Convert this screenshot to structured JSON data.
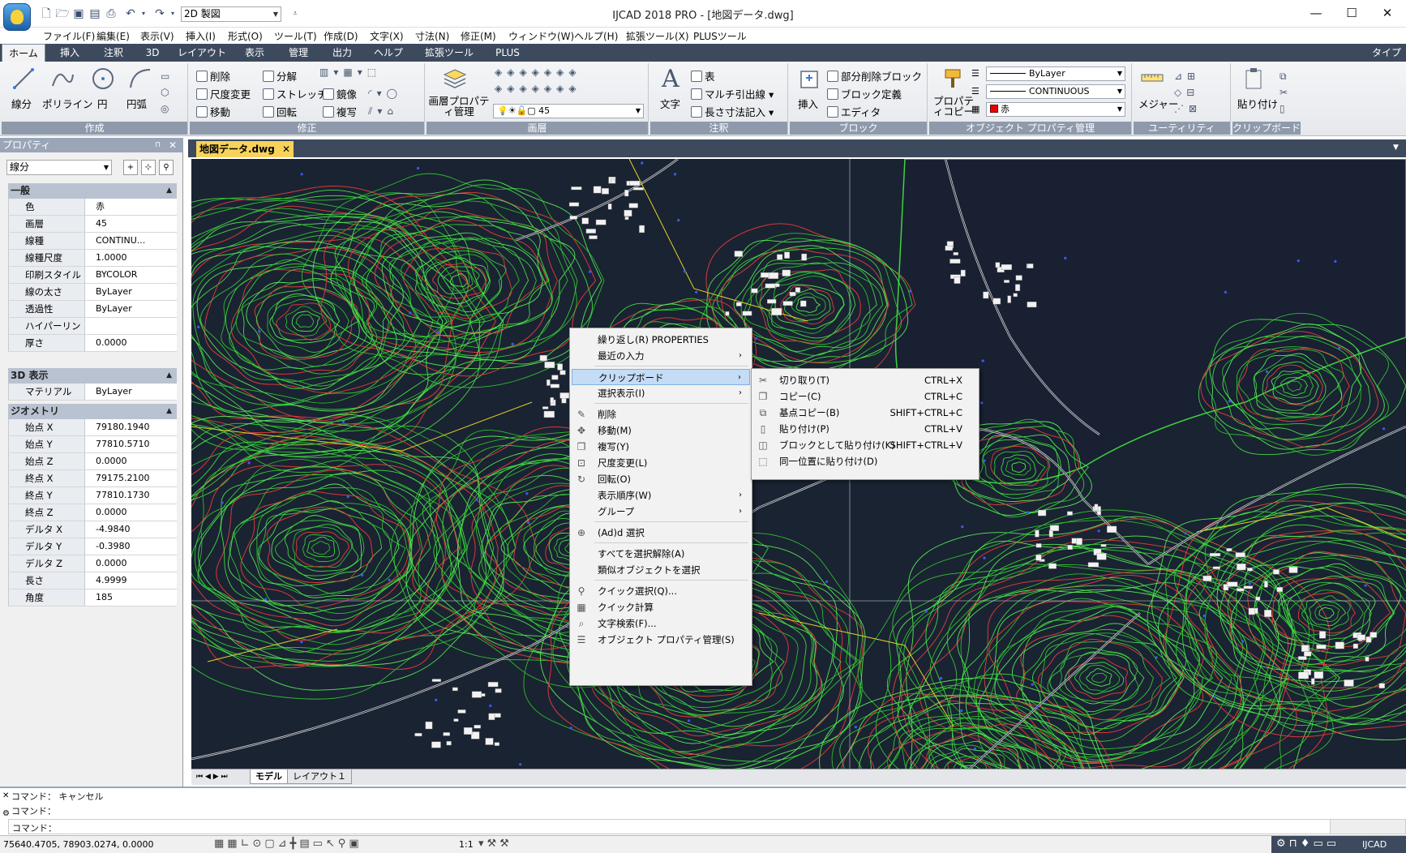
{
  "window": {
    "workspace": "2D 製図",
    "title": "IJCAD 2018 PRO - [地図データ.dwg]",
    "minimize": "—",
    "maximize": "☐",
    "close": "✕"
  },
  "menubar": [
    "ファイル(F)",
    "編集(E)",
    "表示(V)",
    "挿入(I)",
    "形式(O)",
    "ツール(T)",
    "作成(D)",
    "文字(X)",
    "寸法(N)",
    "修正(M)",
    "ウィンドウ(W)",
    "ヘルプ(H)",
    "拡張ツール(X)",
    "PLUSツール"
  ],
  "ribbon_tabs": [
    "ホーム",
    "挿入",
    "注釈",
    "3D",
    "レイアウト",
    "表示",
    "管理",
    "出力",
    "ヘルプ",
    "拡張ツール",
    "PLUS"
  ],
  "ribbon_right": "タイプ",
  "ribbon": {
    "draw": {
      "title": "作成",
      "line": "線分",
      "polyline": "ポリライン",
      "circle": "円",
      "arc": "円弧"
    },
    "modify": {
      "title": "修正",
      "erase": "削除",
      "explode": "分解",
      "scale": "尺度変更",
      "stretch": "ストレッチ",
      "mirror": "鏡像",
      "move": "移動",
      "rotate": "回転",
      "copy": "複写"
    },
    "layer": {
      "title": "画層",
      "manager": "画層プロパティ管理",
      "current_layer": "45"
    },
    "annotation": {
      "title": "注釈",
      "text": "文字",
      "table": "表",
      "mleader": "マルチ引出線",
      "dimension": "長さ寸法記入"
    },
    "block": {
      "title": "ブロック",
      "insert": "挿入",
      "partial_delete": "部分削除ブロック",
      "define": "ブロック定義",
      "editor": "エディタ"
    },
    "properties": {
      "title": "オブジェクト プロパティ管理",
      "match": "プロパティコピー",
      "lineweight": "ByLayer",
      "linetype": "CONTINUOUS",
      "color": "赤"
    },
    "utilities": {
      "title": "ユーティリティ",
      "measure": "メジャー"
    },
    "clipboard": {
      "title": "クリップボード",
      "paste": "貼り付け"
    }
  },
  "properties_panel": {
    "title": "プロパティ",
    "object_type": "線分",
    "sections": {
      "general": "一般",
      "display3d": "3D 表示",
      "geometry": "ジオメトリ"
    },
    "general": [
      {
        "k": "色",
        "v": "赤"
      },
      {
        "k": "画層",
        "v": "45"
      },
      {
        "k": "線種",
        "v": "CONTINU..."
      },
      {
        "k": "線種尺度",
        "v": "1.0000"
      },
      {
        "k": "印刷スタイル",
        "v": "BYCOLOR"
      },
      {
        "k": "線の太さ",
        "v": "ByLayer"
      },
      {
        "k": "透過性",
        "v": "ByLayer"
      },
      {
        "k": "ハイパーリンク",
        "v": ""
      },
      {
        "k": "厚さ",
        "v": "0.0000"
      }
    ],
    "display3d": [
      {
        "k": "マテリアル",
        "v": "ByLayer"
      }
    ],
    "geometry": [
      {
        "k": "始点 X",
        "v": "79180.1940"
      },
      {
        "k": "始点 Y",
        "v": "77810.5710"
      },
      {
        "k": "始点 Z",
        "v": "0.0000"
      },
      {
        "k": "終点 X",
        "v": "79175.2100"
      },
      {
        "k": "終点 Y",
        "v": "77810.1730"
      },
      {
        "k": "終点 Z",
        "v": "0.0000"
      },
      {
        "k": "デルタ X",
        "v": "-4.9840"
      },
      {
        "k": "デルタ Y",
        "v": "-0.3980"
      },
      {
        "k": "デルタ Z",
        "v": "0.0000"
      },
      {
        "k": "長さ",
        "v": "4.9999"
      },
      {
        "k": "角度",
        "v": "185"
      }
    ]
  },
  "document": {
    "tab": "地図データ.dwg",
    "close": "✕"
  },
  "layout_tabs": {
    "model": "モデル",
    "layout1": "レイアウト１"
  },
  "context_menu": {
    "items": [
      {
        "label": "繰り返し(R) PROPERTIES"
      },
      {
        "label": "最近の入力",
        "sub": true
      },
      {
        "label": "クリップボード",
        "sub": true,
        "highlight": true
      },
      {
        "label": "選択表示(I)",
        "sub": true
      },
      {
        "label": "削除",
        "icon": "erase"
      },
      {
        "label": "移動(M)",
        "icon": "move"
      },
      {
        "label": "複写(Y)",
        "icon": "copy"
      },
      {
        "label": "尺度変更(L)",
        "icon": "scale"
      },
      {
        "label": "回転(O)",
        "icon": "rotate"
      },
      {
        "label": "表示順序(W)",
        "sub": true
      },
      {
        "label": "グループ",
        "sub": true
      },
      {
        "label": "(Ad)d 選択",
        "icon": "add-select"
      },
      {
        "label": "すべてを選択解除(A)"
      },
      {
        "label": "類似オブジェクトを選択"
      },
      {
        "label": "クイック選択(Q)...",
        "icon": "quick-select"
      },
      {
        "label": "クイック計算",
        "icon": "calculator"
      },
      {
        "label": "文字検索(F)...",
        "icon": "find"
      },
      {
        "label": "オブジェクト プロパティ管理(S)",
        "icon": "properties"
      }
    ]
  },
  "clipboard_submenu": {
    "items": [
      {
        "label": "切り取り(T)",
        "shortcut": "CTRL+X",
        "icon": "cut"
      },
      {
        "label": "コピー(C)",
        "shortcut": "CTRL+C",
        "icon": "copy"
      },
      {
        "label": "基点コピー(B)",
        "shortcut": "SHIFT+CTRL+C",
        "icon": "copy-base"
      },
      {
        "label": "貼り付け(P)",
        "shortcut": "CTRL+V",
        "icon": "paste"
      },
      {
        "label": "ブロックとして貼り付け(K)",
        "shortcut": "SHIFT+CTRL+V",
        "icon": "paste-block"
      },
      {
        "label": "同一位置に貼り付け(D)",
        "shortcut": "",
        "icon": "paste-orig"
      }
    ]
  },
  "command_line": {
    "line1": "コマンド： キャンセル",
    "line2": "コマンド：",
    "prompt": "コマンド："
  },
  "status_bar": {
    "coordinates": "75640.4705, 78903.0274, 0.0000",
    "scale": "1:1",
    "app": "IJCAD"
  },
  "colors": {
    "ribbon_tab_bg": "#3d4a5e",
    "doc_tab": "#f7d35a",
    "canvas": "#1a2332",
    "contour_green": "#3fd43f",
    "highlight": "#c4dcf6"
  }
}
